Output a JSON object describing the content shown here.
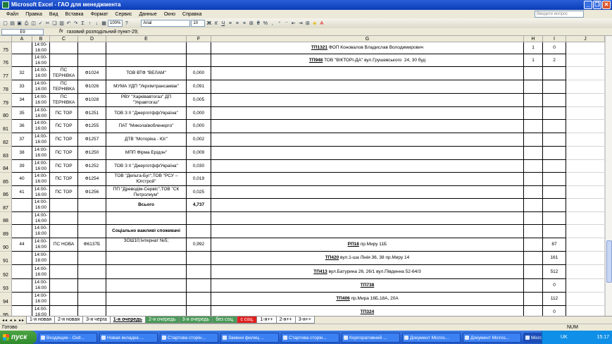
{
  "window": {
    "title": "Microsoft Excel - ГАО для менеджмента"
  },
  "menu": {
    "items": [
      "Файл",
      "Правка",
      "Вид",
      "Вставка",
      "Формат",
      "Сервис",
      "Данные",
      "Окно",
      "Справка"
    ],
    "help_placeholder": "Введите вопрос"
  },
  "toolbar": {
    "zoom": "100%",
    "font": "Arial",
    "size": "10"
  },
  "formula_bar": {
    "cell_ref": "E9",
    "fx": "fx",
    "formula": "газовий розподільний пункт-29;"
  },
  "columns": [
    "A",
    "B",
    "C",
    "D",
    "E",
    "F",
    "G",
    "H",
    "I",
    "J"
  ],
  "rows": [
    {
      "num": "75",
      "a": "",
      "b": "14:00-\n16:00",
      "c": "",
      "d": "",
      "e": "",
      "f": "",
      "g_code": "ТП1321",
      "g_text": " ФОП Коновалов Владислав Володимирович",
      "h": "1",
      "i": "0"
    },
    {
      "num": "76",
      "a": "",
      "b": "14:00-\n16:00",
      "c": "",
      "d": "",
      "e": "",
      "f": "",
      "g_code": "ТП948",
      "g_text": " ТОВ \"ВІКТОРІ-ДА\" вул.Грушевського  24, 30 буд",
      "h": "1",
      "i": "2"
    },
    {
      "num": "77",
      "a": "32",
      "b": "14:00-\n16:00",
      "c": "ПС\nТЕРНІВКА",
      "d": "Ф1024",
      "e": "ТОВ ВТФ \"ВЕЛАМ\"",
      "f": "0,000",
      "g_code": "",
      "g_text": "",
      "h": "",
      "i": ""
    },
    {
      "num": "78",
      "a": "33",
      "b": "14:00-\n16:00",
      "c": "ПС\nТЕРНІВКА",
      "d": "Ф1026",
      "e": "МУМА  УДП \"Укрхімтрансаміак\"",
      "f": "0,091",
      "g_code": "",
      "g_text": "",
      "h": "",
      "i": ""
    },
    {
      "num": "79",
      "a": "34",
      "b": "14:00-\n16:00",
      "c": "ПС\nТЕРНІВКА",
      "d": "Ф1028",
      "e": "РВУ \"Харківавтогаз\" ДП\n\"Укравтогаз\"",
      "f": "0,005",
      "g_code": "",
      "g_text": "",
      "h": "",
      "i": ""
    },
    {
      "num": "80",
      "a": "35",
      "b": "14:00-\n16:00",
      "c": "ПС ТОР",
      "d": "Ф1251",
      "e": "ТОВ З ІІ \"Джерготфф/Україна\"",
      "f": "0,000",
      "g_code": "",
      "g_text": "",
      "h": "",
      "i": ""
    },
    {
      "num": "81",
      "a": "36",
      "b": "14:00-\n16:00",
      "c": "ПС ТОР",
      "d": "Ф1255",
      "e": "ПАТ \"Миколаївобленерго\"",
      "f": "0,000",
      "g_code": "",
      "g_text": "",
      "h": "",
      "i": ""
    },
    {
      "num": "82",
      "a": "37",
      "b": "14:00-\n16:00",
      "c": "ПС ТОР",
      "d": "Ф1257",
      "e": "ДТВ \"Моторіка - Юг\"",
      "f": "0,002",
      "g_code": "",
      "g_text": "",
      "h": "",
      "i": ""
    },
    {
      "num": "83",
      "a": "38",
      "b": "14:00-\n16:00",
      "c": "ПС ТОР",
      "d": "Ф1250",
      "e": "МПП Фірма   Ерідон\"",
      "f": "0,009",
      "g_code": "",
      "g_text": "",
      "h": "",
      "i": ""
    },
    {
      "num": "84",
      "a": "39",
      "b": "14:00-\n16:00",
      "c": "ПС ТОР",
      "d": "Ф1252",
      "e": "ТОВ З ІІ \"Джерготфф/Україна\"",
      "f": "0,030",
      "g_code": "",
      "g_text": "",
      "h": "",
      "i": ""
    },
    {
      "num": "85",
      "a": "40",
      "b": "14:00-\n16:00",
      "c": "ПС ТОР",
      "d": "Ф1254",
      "e": "ТОВ \"Дельта-Буг\",ТОВ \"РСУ –\nЮгстрой\"",
      "f": "0,019",
      "g_code": "",
      "g_text": "",
      "h": "",
      "i": ""
    },
    {
      "num": "86",
      "a": "41",
      "b": "14:00-\n16:00",
      "c": "ПС ТОР",
      "d": "Ф1256",
      "e": "ПП \"Древодім-Сервіс\",ТОВ \"СК\nПетролиум\"",
      "f": "0,025",
      "g_code": "",
      "g_text": "",
      "h": "",
      "i": ""
    },
    {
      "num": "87",
      "a": "",
      "b": "14:00-\n16:00",
      "c": "",
      "d": "",
      "e": "Всього",
      "f": "4,737",
      "g_code": "",
      "g_text": "",
      "h": "",
      "i": "",
      "bold": true
    },
    {
      "num": "88",
      "a": "",
      "b": "14:00-\n16:00",
      "c": "",
      "d": "",
      "e": "",
      "f": "",
      "g_code": "",
      "g_text": "",
      "h": "",
      "i": ""
    },
    {
      "num": "89",
      "a": "",
      "b": "14:00-\n16:00",
      "c": "",
      "d": "",
      "e": "Соціально важливі споживачі",
      "f": "",
      "g_code": "",
      "g_text": "",
      "h": "",
      "i": "",
      "bold": true
    },
    {
      "num": "90",
      "a": "44",
      "b": "14:00-\n16:00",
      "c": "ПС НОВА",
      "d": "Ф6137Б",
      "e": "ЗОШ10;Інтернат №5;",
      "f": "0,992",
      "g_code": "РП18",
      "g_text": " пр.Миру 11Б",
      "h": "",
      "i": "87",
      "etop": true
    },
    {
      "num": "91",
      "a": "",
      "b": "14:00-\n16:00",
      "c": "",
      "d": "",
      "e": "",
      "f": "",
      "g_code": "ТП420",
      "g_text": " вул.1-ша Лінія 36, 38 пр.Миру 14",
      "h": "",
      "i": "161"
    },
    {
      "num": "92",
      "a": "",
      "b": "14:00-\n16:00",
      "c": "",
      "d": "",
      "e": "",
      "f": "",
      "g_code": "ТП413",
      "g_text": " вул.Батурина 26, 26/1 вул.Південна 52-64/3",
      "h": "",
      "i": "512"
    },
    {
      "num": "93",
      "a": "",
      "b": "14:00-\n16:00",
      "c": "",
      "d": "",
      "e": "",
      "f": "",
      "g_code": "ТП738",
      "g_text": "",
      "h": "",
      "i": "0"
    },
    {
      "num": "94",
      "a": "",
      "b": "14:00-\n16:00",
      "c": "",
      "d": "",
      "e": "",
      "f": "",
      "g_code": "ТП406",
      "g_text": " пр.Мира 16Б,18А, 20А",
      "h": "",
      "i": "112"
    },
    {
      "num": "95",
      "a": "",
      "b": "14:00-\n16:00",
      "c": "",
      "d": "",
      "e": "",
      "f": "",
      "g_code": "ТП324",
      "g_text": "",
      "h": "",
      "i": "0"
    }
  ],
  "sheets": [
    {
      "label": "1-я новая",
      "style": ""
    },
    {
      "label": "2-я новая",
      "style": ""
    },
    {
      "label": "3-я черга",
      "style": ""
    },
    {
      "label": "1-я очередь",
      "style": "active"
    },
    {
      "label": "2-я очередь",
      "style": "colored"
    },
    {
      "label": "3-я очередь",
      "style": "colored"
    },
    {
      "label": "без соц.",
      "style": "colored"
    },
    {
      "label": "с соц.",
      "style": "red"
    },
    {
      "label": "1-я++",
      "style": ""
    },
    {
      "label": "2-я++",
      "style": ""
    },
    {
      "label": "3-я++",
      "style": ""
    }
  ],
  "status": {
    "left": "Готово",
    "num": "NUM"
  },
  "taskbar": {
    "start": "пуск",
    "tasks": [
      "Входящие - Outl...",
      "Новая вкладка ...",
      "Стартова сторін...",
      "Замкни филиц ...",
      "Стартова сторін...",
      "Корпоративний ...",
      "Документ Micros...",
      "Документ Micros...",
      "Microsoft Excel - ..."
    ],
    "lang": "UK",
    "clock": "15:17"
  }
}
